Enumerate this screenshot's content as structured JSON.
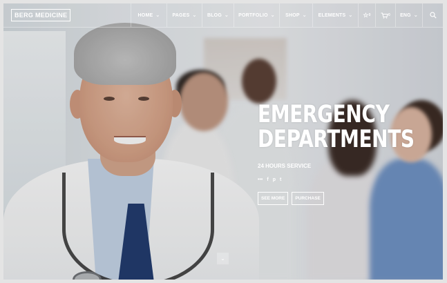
{
  "logo": {
    "text": "BERG MEDICINE"
  },
  "nav": {
    "items": [
      {
        "label": "HOME"
      },
      {
        "label": "PAGES"
      },
      {
        "label": "BLOG"
      },
      {
        "label": "PORTFOLIO"
      },
      {
        "label": "SHOP"
      },
      {
        "label": "ELEMENTS"
      }
    ],
    "wishlist_count": "0",
    "cart_count": "0",
    "language": "ENG"
  },
  "hero": {
    "title_line1": "EMERGENCY",
    "title_line2": "DEPARTMENTS",
    "subtitle": "24 HOURS SERVICE",
    "share_icons": [
      "share-icon",
      "facebook-icon",
      "pinterest-icon",
      "twitter-icon"
    ],
    "see_more_label": "SEE MORE",
    "purchase_label": "PURCHASE"
  },
  "colors": {
    "text": "#ffffff",
    "tie": "#1f3a6e",
    "scrub": "#6f93c6"
  }
}
